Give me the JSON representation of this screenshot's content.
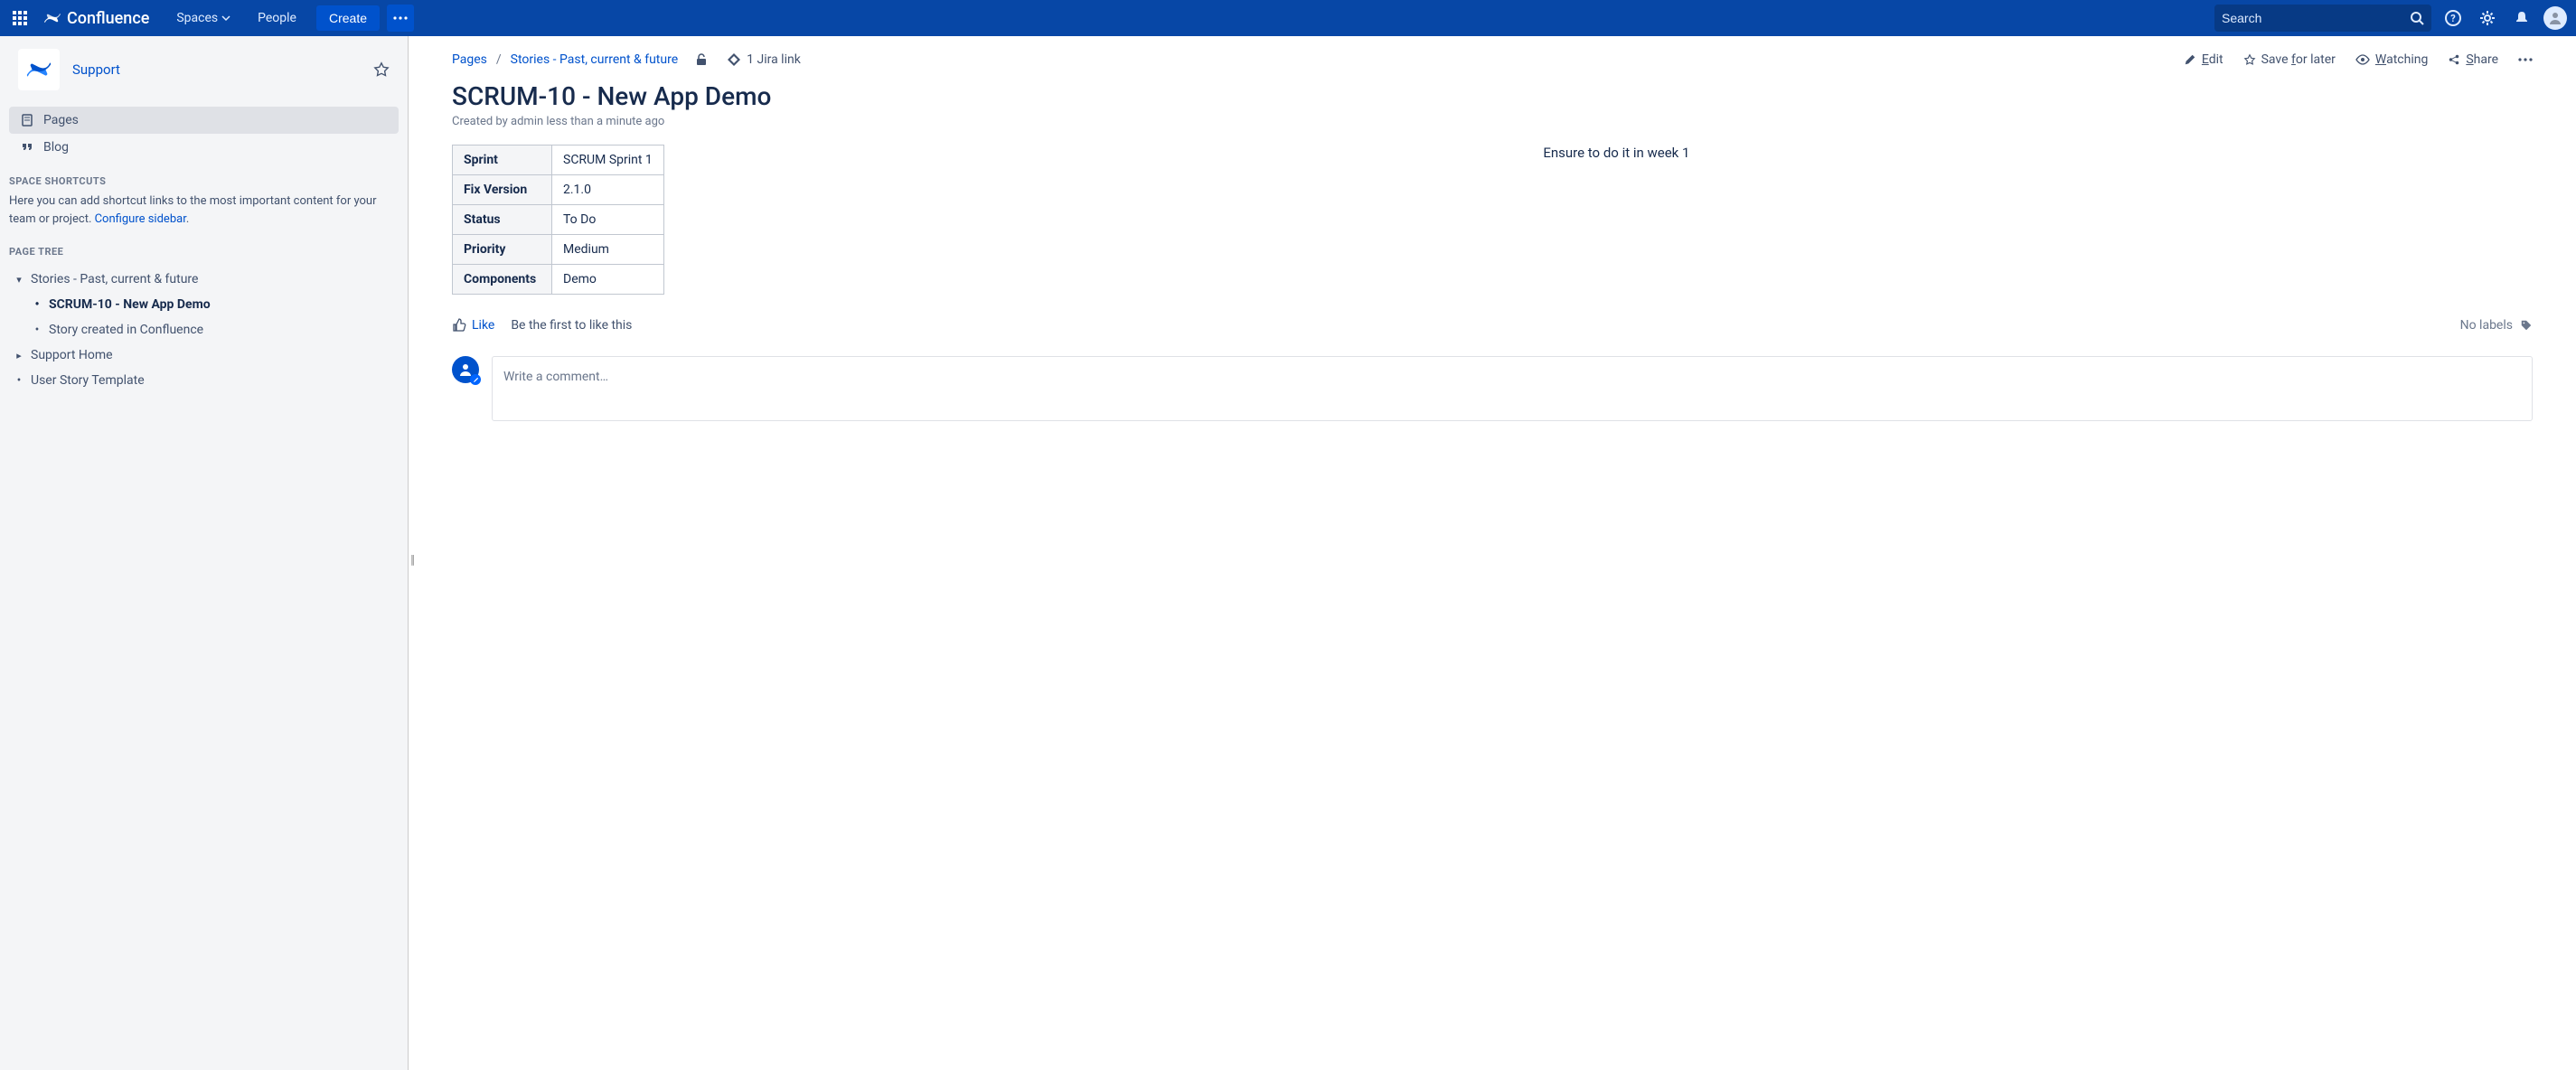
{
  "nav": {
    "product": "Confluence",
    "spaces": "Spaces",
    "people": "People",
    "create": "Create",
    "search_placeholder": "Search"
  },
  "sidebar": {
    "space_name": "Support",
    "pages": "Pages",
    "blog": "Blog",
    "shortcuts_heading": "SPACE SHORTCUTS",
    "shortcuts_text": "Here you can add shortcut links to the most important content for your team or project. ",
    "configure_link": "Configure sidebar",
    "tree_heading": "PAGE TREE",
    "tree": {
      "stories": "Stories - Past, current & future",
      "scrum10": "SCRUM-10 - New App Demo",
      "story_conf": "Story created in Confluence",
      "support_home": "Support Home",
      "template": "User Story Template"
    }
  },
  "breadcrumb": {
    "pages": "Pages",
    "parent": "Stories - Past, current & future",
    "jira": "1 Jira link"
  },
  "actions": {
    "edit": "Edit",
    "save": "Save for later",
    "watching": "Watching",
    "share": "Share"
  },
  "page": {
    "title": "SCRUM-10 - New App Demo",
    "meta": "Created by admin less than a minute ago",
    "note": "Ensure to do it in week 1"
  },
  "table": {
    "r1k": "Sprint",
    "r1v": "SCRUM Sprint 1",
    "r2k": "Fix Version",
    "r2v": "2.1.0",
    "r3k": "Status",
    "r3v": "To Do",
    "r4k": "Priority",
    "r4v": "Medium",
    "r5k": "Components",
    "r5v": "Demo"
  },
  "footer": {
    "like": "Like",
    "like_hint": "Be the first to like this",
    "no_labels": "No labels",
    "comment_placeholder": "Write a comment…"
  }
}
